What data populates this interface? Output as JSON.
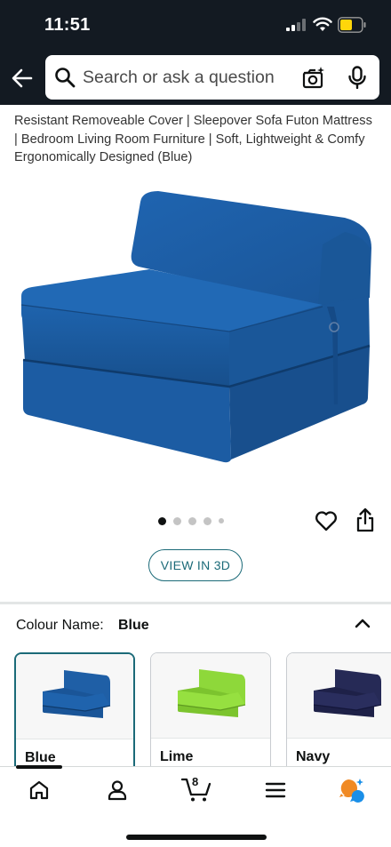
{
  "status_bar": {
    "time": "11:51"
  },
  "search": {
    "placeholder": "Search or ask a question"
  },
  "product": {
    "title": "Resistant Removeable Cover | Sleepover Sofa Futon Mattress | Bedroom Living Room Furniture | Soft, Lightweight & Comfy Ergonomically Designed (Blue)",
    "image_color": "#1f5fa6",
    "carousel": {
      "total_dots": 5,
      "active_index": 0
    },
    "view_3d_label": "VIEW IN 3D"
  },
  "colour": {
    "label": "Colour Name:",
    "selected": "Blue",
    "options": [
      {
        "name": "Blue",
        "color": "#1f5fa6",
        "selected": true
      },
      {
        "name": "Lime",
        "color": "#8ed83a",
        "selected": false
      },
      {
        "name": "Navy",
        "color": "#242650",
        "selected": false
      }
    ]
  },
  "bottom_nav": {
    "items": [
      "home-icon",
      "account-icon",
      "cart-icon",
      "menu-icon",
      "rufus-icon"
    ],
    "cart_count": "8"
  },
  "colors": {
    "header_bg": "#131a22",
    "accent": "#1b6a78",
    "rufus_orange": "#f08a24",
    "rufus_blue": "#1a8fe8"
  }
}
